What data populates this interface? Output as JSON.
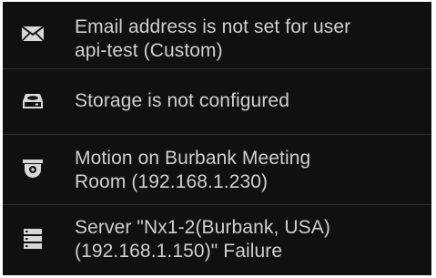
{
  "notifications": [
    {
      "icon": "envelope-icon",
      "lines": [
        "Email address is not set for user",
        "api-test (Custom)"
      ]
    },
    {
      "icon": "storage-drive-icon",
      "lines": [
        "Storage is not configured"
      ]
    },
    {
      "icon": "camera-icon",
      "lines": [
        "Motion on Burbank Meeting",
        "Room (192.168.1.230)"
      ]
    },
    {
      "icon": "server-icon",
      "lines": [
        "Server \"Nx1-2(Burbank, USA)",
        "(192.168.1.150)\" Failure"
      ]
    }
  ],
  "colors": {
    "panel_background": "#101010",
    "text": "#cfcfcf",
    "icon": "#d8d8d8",
    "divider": "#303030"
  }
}
